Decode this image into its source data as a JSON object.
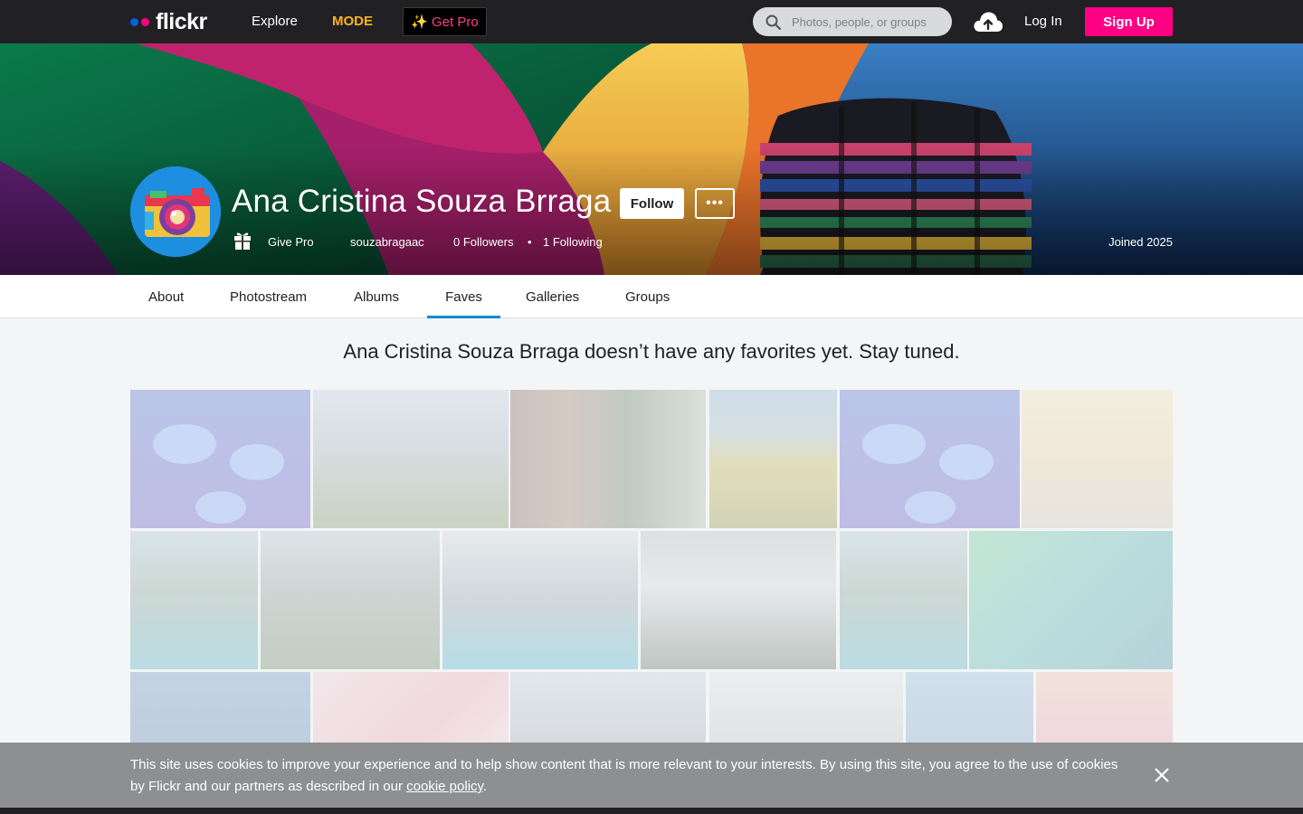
{
  "topnav": {
    "logo_text": "flickr",
    "explore": "Explore",
    "mode": "MODE",
    "get_pro": "Get Pro",
    "search_placeholder": "Photos, people, or groups",
    "login": "Log In",
    "signup": "Sign Up"
  },
  "profile": {
    "name": "Ana Cristina Souza Brraga",
    "follow": "Follow",
    "more": "•••",
    "give_pro": "Give Pro",
    "username": "souzabragaac",
    "followers": "0 Followers",
    "separator": "•",
    "following": "1 Following",
    "joined": "Joined 2025"
  },
  "tabs": [
    "About",
    "Photostream",
    "Albums",
    "Faves",
    "Galleries",
    "Groups"
  ],
  "active_tab": "Faves",
  "main": {
    "empty_message": "Ana Cristina Souza Brraga doesn’t have any favorites yet. Stay tuned."
  },
  "cookie": {
    "text_before": "This site uses cookies to improve your experience and to help show content that is more relevant to your interests. By using this site, you agree to the use of cookies by Flickr and our partners as described in our ",
    "link": "cookie policy",
    "text_after": "."
  },
  "colors": {
    "nav_bg": "#212124",
    "brand_pink": "#ff0084",
    "brand_blue": "#0063dc",
    "mode_yellow": "#fcb41d",
    "tab_active": "#008ecf",
    "cookie_bg": "#8d8f91"
  },
  "icons": [
    "search-icon",
    "upload-cloud-icon",
    "gift-icon",
    "close-icon",
    "camera-avatar-icon"
  ]
}
